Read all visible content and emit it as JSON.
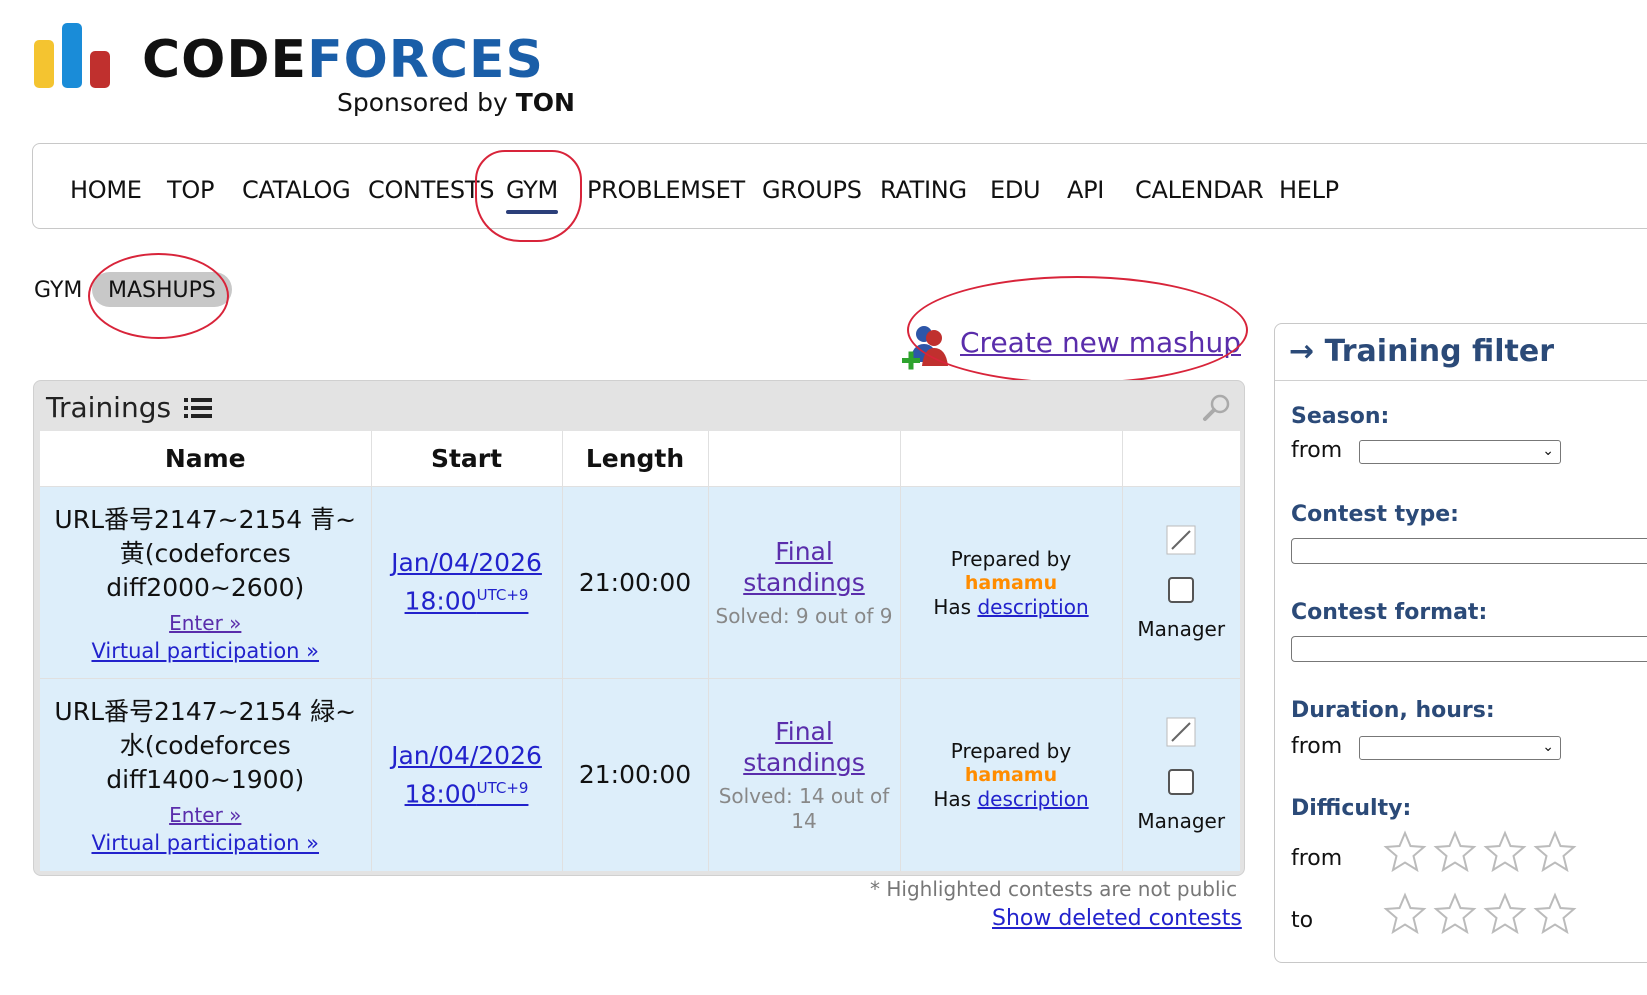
{
  "logo": {
    "part1": "CODE",
    "part2": "FORCES",
    "sponsor_prefix": "Sponsored by ",
    "sponsor_name": "TON"
  },
  "menu": [
    {
      "label": "HOME"
    },
    {
      "label": "TOP"
    },
    {
      "label": "CATALOG"
    },
    {
      "label": "CONTESTS"
    },
    {
      "label": "GYM"
    },
    {
      "label": "PROBLEMSET"
    },
    {
      "label": "GROUPS"
    },
    {
      "label": "RATING"
    },
    {
      "label": "EDU"
    },
    {
      "label": "API"
    },
    {
      "label": "CALENDAR"
    },
    {
      "label": "HELP"
    }
  ],
  "active_menu": "GYM",
  "submenu": {
    "gym": "GYM",
    "mashups": "MASHUPS"
  },
  "create_mashup": "Create new mashup",
  "trainings": {
    "title": "Trainings",
    "columns": {
      "name": "Name",
      "start": "Start",
      "length": "Length"
    },
    "rows": [
      {
        "name": "URL番号2147~2154 青~黄(codeforces diff2000~2600)",
        "enter": "Enter »",
        "virtual": "Virtual participation »",
        "date": "Jan/04/2026",
        "time": "18:00",
        "tz": "UTC+9",
        "length": "21:00:00",
        "standings": "Final standings",
        "solved": "Solved: 9 out of 9",
        "prepared_by": "Prepared by",
        "author": "hamamu",
        "has": "Has",
        "description": "description",
        "manager": "Manager"
      },
      {
        "name": "URL番号2147~2154 緑~水(codeforces diff1400~1900)",
        "enter": "Enter »",
        "virtual": "Virtual participation »",
        "date": "Jan/04/2026",
        "time": "18:00",
        "tz": "UTC+9",
        "length": "21:00:00",
        "standings": "Final standings",
        "solved": "Solved: 14 out of 14",
        "prepared_by": "Prepared by",
        "author": "hamamu",
        "has": "Has",
        "description": "description",
        "manager": "Manager"
      }
    ]
  },
  "note": "* Highlighted contests are not public",
  "show_deleted": "Show deleted contests",
  "filter": {
    "title": "→ Training filter",
    "season": "Season:",
    "from": "from",
    "contest_type": "Contest type:",
    "contest_format": "Contest format:",
    "duration": "Duration, hours:",
    "difficulty": "Difficulty:",
    "to": "to"
  },
  "colors": {
    "accent": "#2b4a78",
    "link": "#2222cc",
    "visited": "#5a2dab",
    "row_bg": "#ddeefa",
    "author": "#ff8c00",
    "highlight_circle": "#d8243a"
  }
}
